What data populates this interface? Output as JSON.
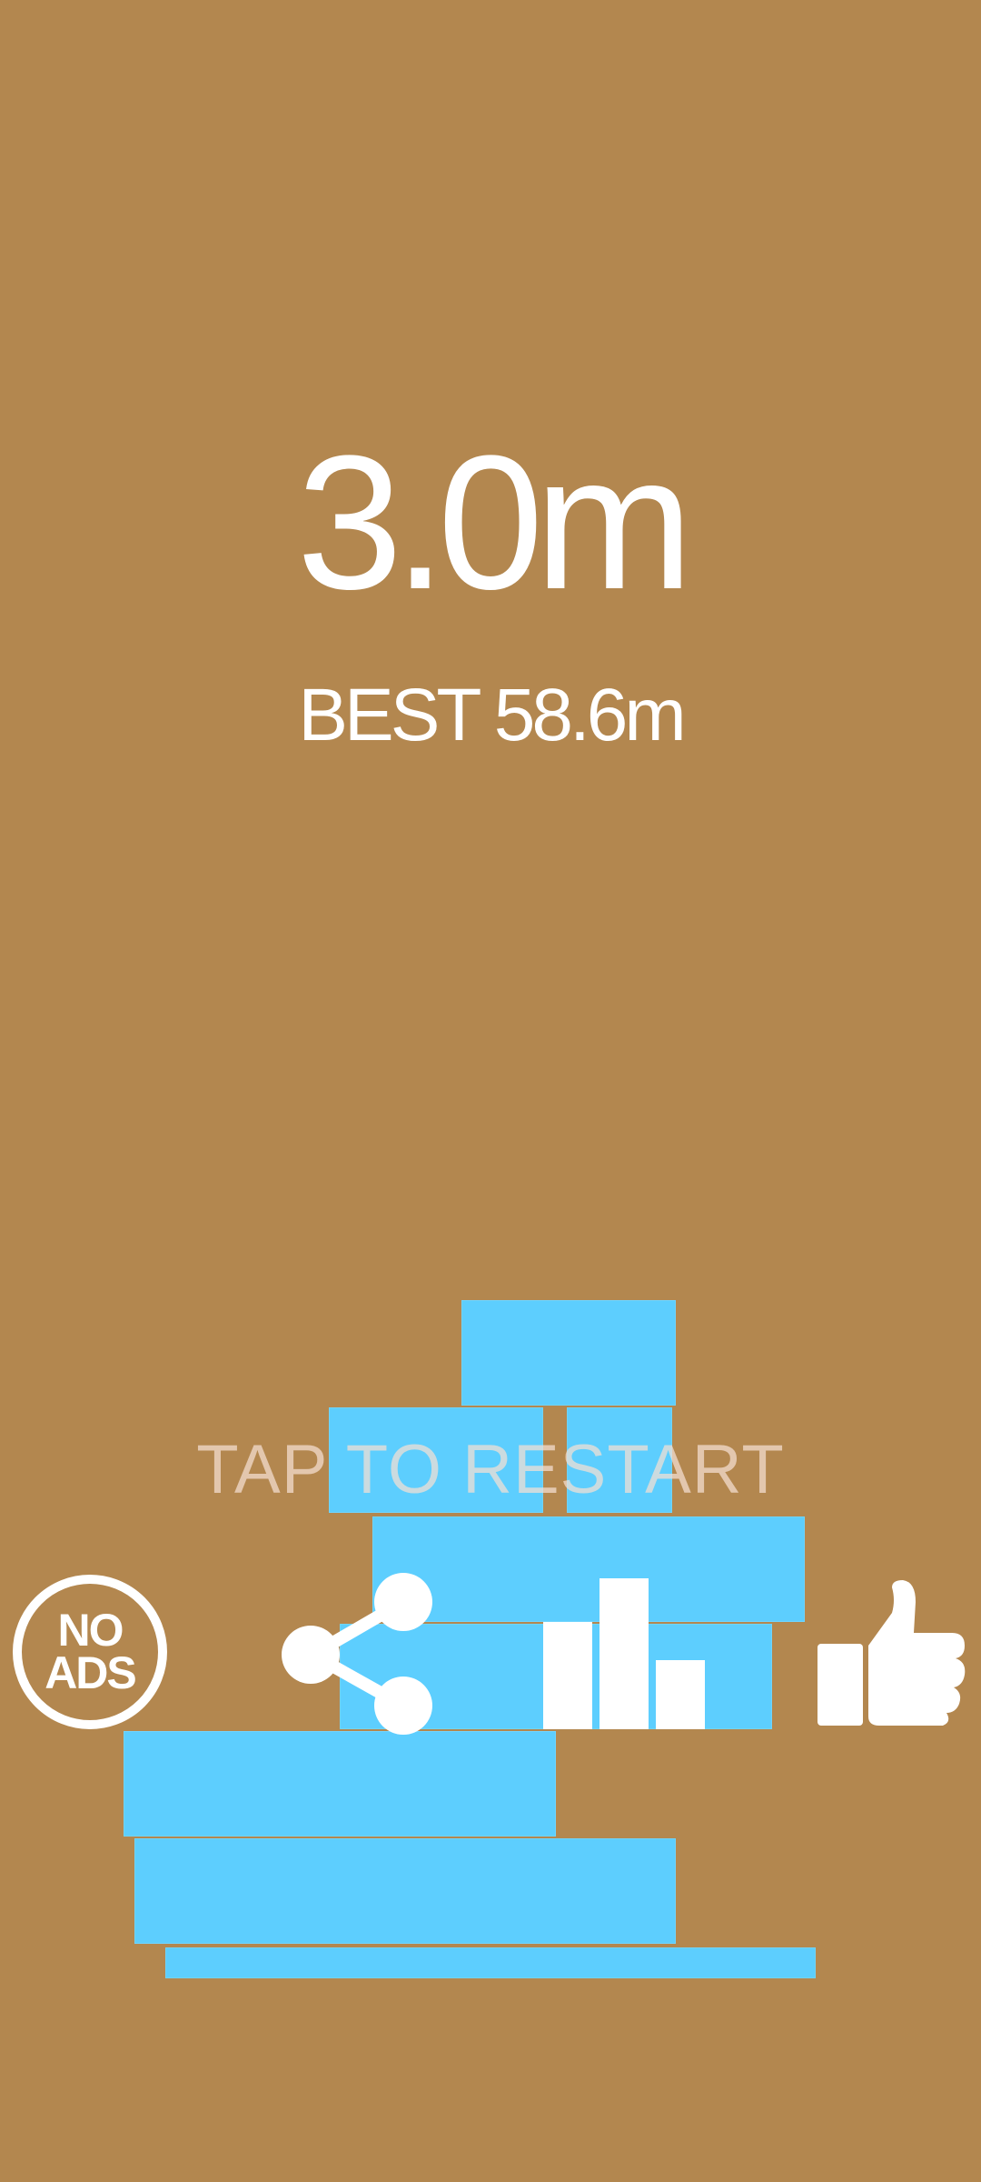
{
  "score": {
    "current": "3.0m",
    "best": "BEST 58.6m"
  },
  "prompt": "TAP TO RESTART",
  "buttons": {
    "no_ads_line1": "NO",
    "no_ads_line2": "ADS",
    "share_icon": "share-icon",
    "leaderboard_icon": "bar-chart-icon",
    "rate_icon": "thumbs-up-icon"
  },
  "colors": {
    "background": "#B3874F",
    "block": "#5DCEFE",
    "text": "#FFFFFF"
  }
}
